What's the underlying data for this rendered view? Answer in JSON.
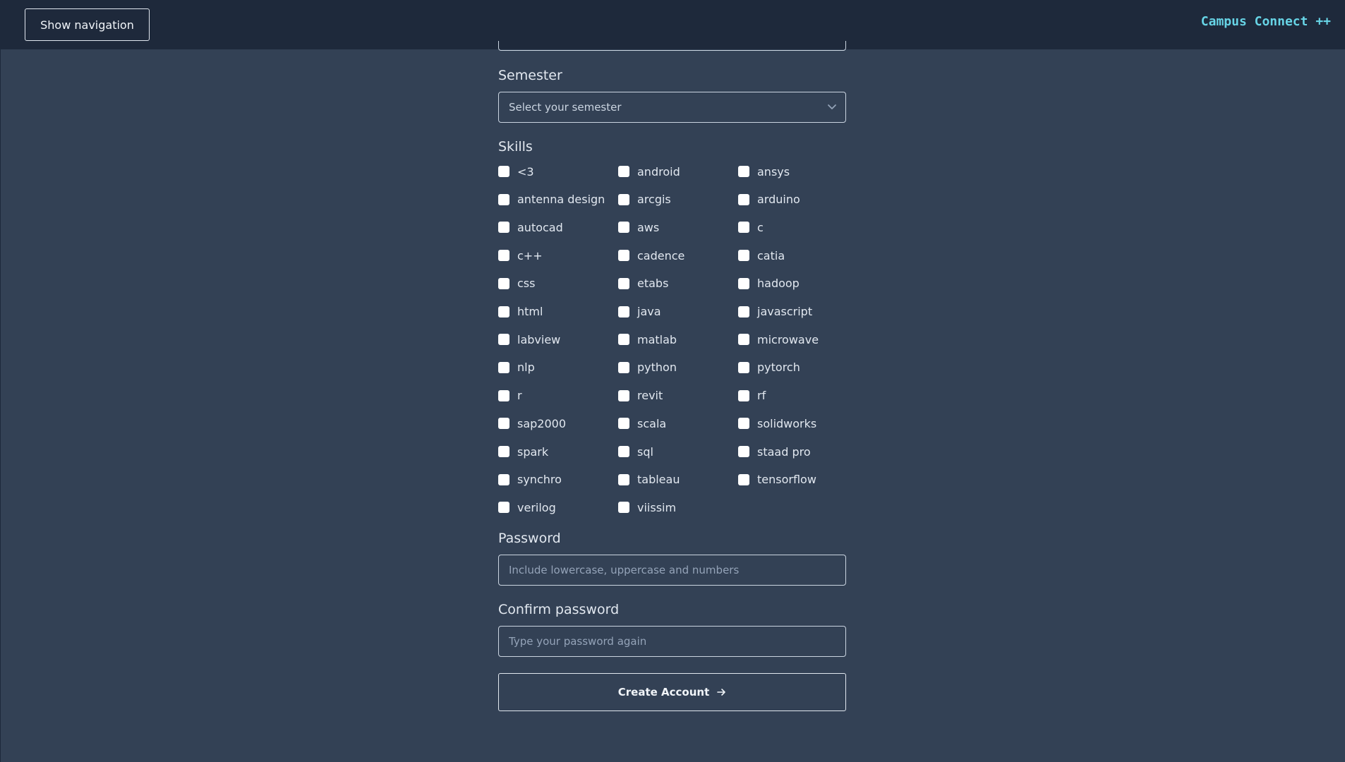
{
  "header": {
    "nav_button": "Show navigation",
    "brand": "Campus Connect ++"
  },
  "form": {
    "semester": {
      "label": "Semester",
      "placeholder": "Select your semester"
    },
    "skills": {
      "label": "Skills",
      "items": [
        "<3",
        "android",
        "ansys",
        "antenna design",
        "arcgis",
        "arduino",
        "autocad",
        "aws",
        "c",
        "c++",
        "cadence",
        "catia",
        "css",
        "etabs",
        "hadoop",
        "html",
        "java",
        "javascript",
        "labview",
        "matlab",
        "microwave",
        "nlp",
        "python",
        "pytorch",
        "r",
        "revit",
        "rf",
        "sap2000",
        "scala",
        "solidworks",
        "spark",
        "sql",
        "staad pro",
        "synchro",
        "tableau",
        "tensorflow",
        "verilog",
        "viissim"
      ]
    },
    "password": {
      "label": "Password",
      "placeholder": "Include lowercase, uppercase and numbers"
    },
    "confirm_password": {
      "label": "Confirm password",
      "placeholder": "Type your password again"
    },
    "submit_label": "Create Account"
  },
  "colors": {
    "page_bg": "#334155",
    "header_bg": "#1e293b",
    "brand": "#67d4e6"
  }
}
